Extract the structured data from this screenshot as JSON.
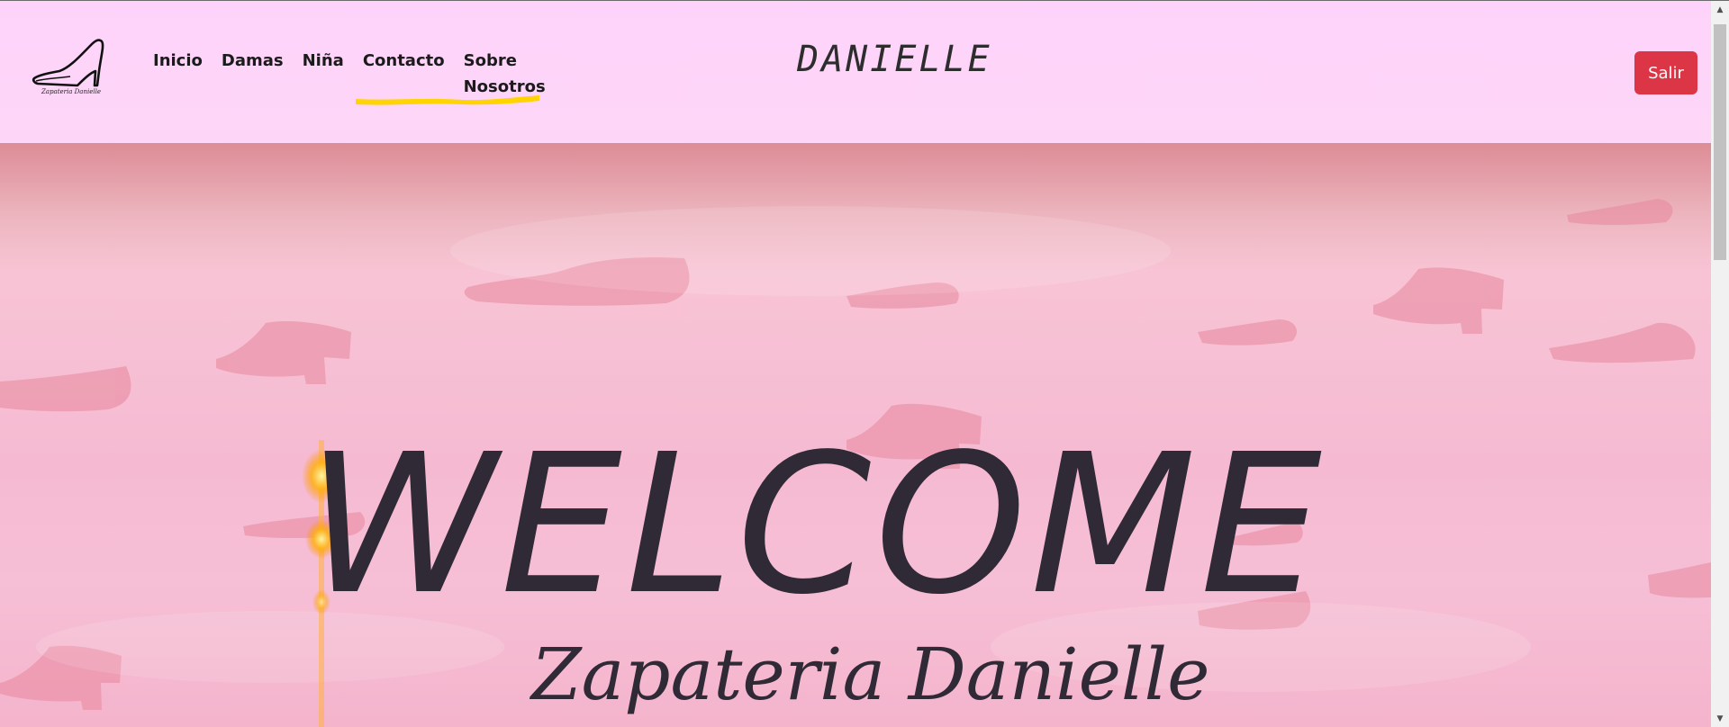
{
  "navbar": {
    "logo_caption": "Zapateria Danielle",
    "links": [
      {
        "label": "Inicio"
      },
      {
        "label": "Damas"
      },
      {
        "label": "Niña"
      },
      {
        "label": "Contacto"
      },
      {
        "label": "Sobre Nosotros"
      }
    ],
    "brand": "DANIELLE",
    "logout_label": "Salir",
    "logout_color": "#dc3545",
    "highlight_color": "#ffd400",
    "background_color": "#fdd6f7"
  },
  "hero": {
    "title": "WELCOME",
    "subtitle": "Zapateria Danielle",
    "text_color": "#2f2a36",
    "background_color": "#f5bad2"
  },
  "scrollbar": {
    "up_icon": "arrow-up-icon",
    "down_icon": "arrow-down-icon"
  }
}
